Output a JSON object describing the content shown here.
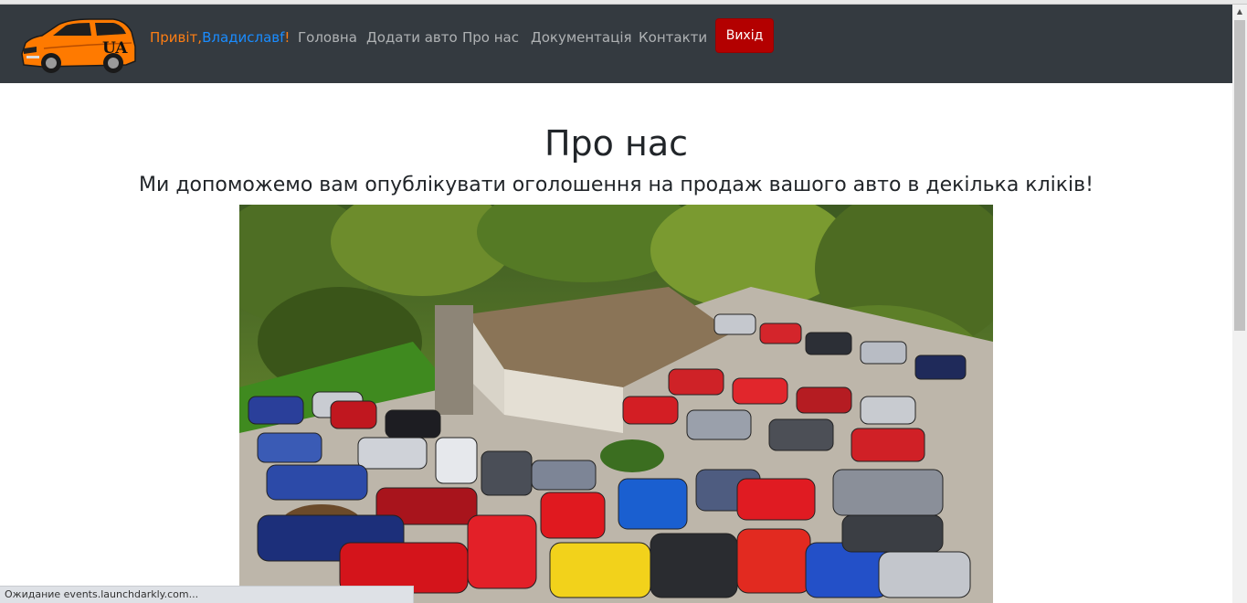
{
  "header": {
    "logo_text": "UA",
    "greeting": {
      "word": "Привіт,",
      "name": "Владиславf",
      "excl": "!"
    },
    "nav": [
      {
        "label": "Головна"
      },
      {
        "label": "Додати авто"
      },
      {
        "label": "Про нас"
      },
      {
        "label": "Документація"
      },
      {
        "label": "Контакти"
      }
    ],
    "logout_label": "Вихід"
  },
  "main": {
    "title": "Про нас",
    "subtitle": "Ми допоможемо вам опублікувати оголошення на продаж вашого авто в декілька кліків!"
  },
  "status_bar": {
    "text": "Ожидание events.launchdarkly.com..."
  },
  "colors": {
    "navbar_bg": "#343a40",
    "greeting_orange": "#fd7e14",
    "greeting_blue": "#1a8cff",
    "logout_red": "#b30000"
  }
}
